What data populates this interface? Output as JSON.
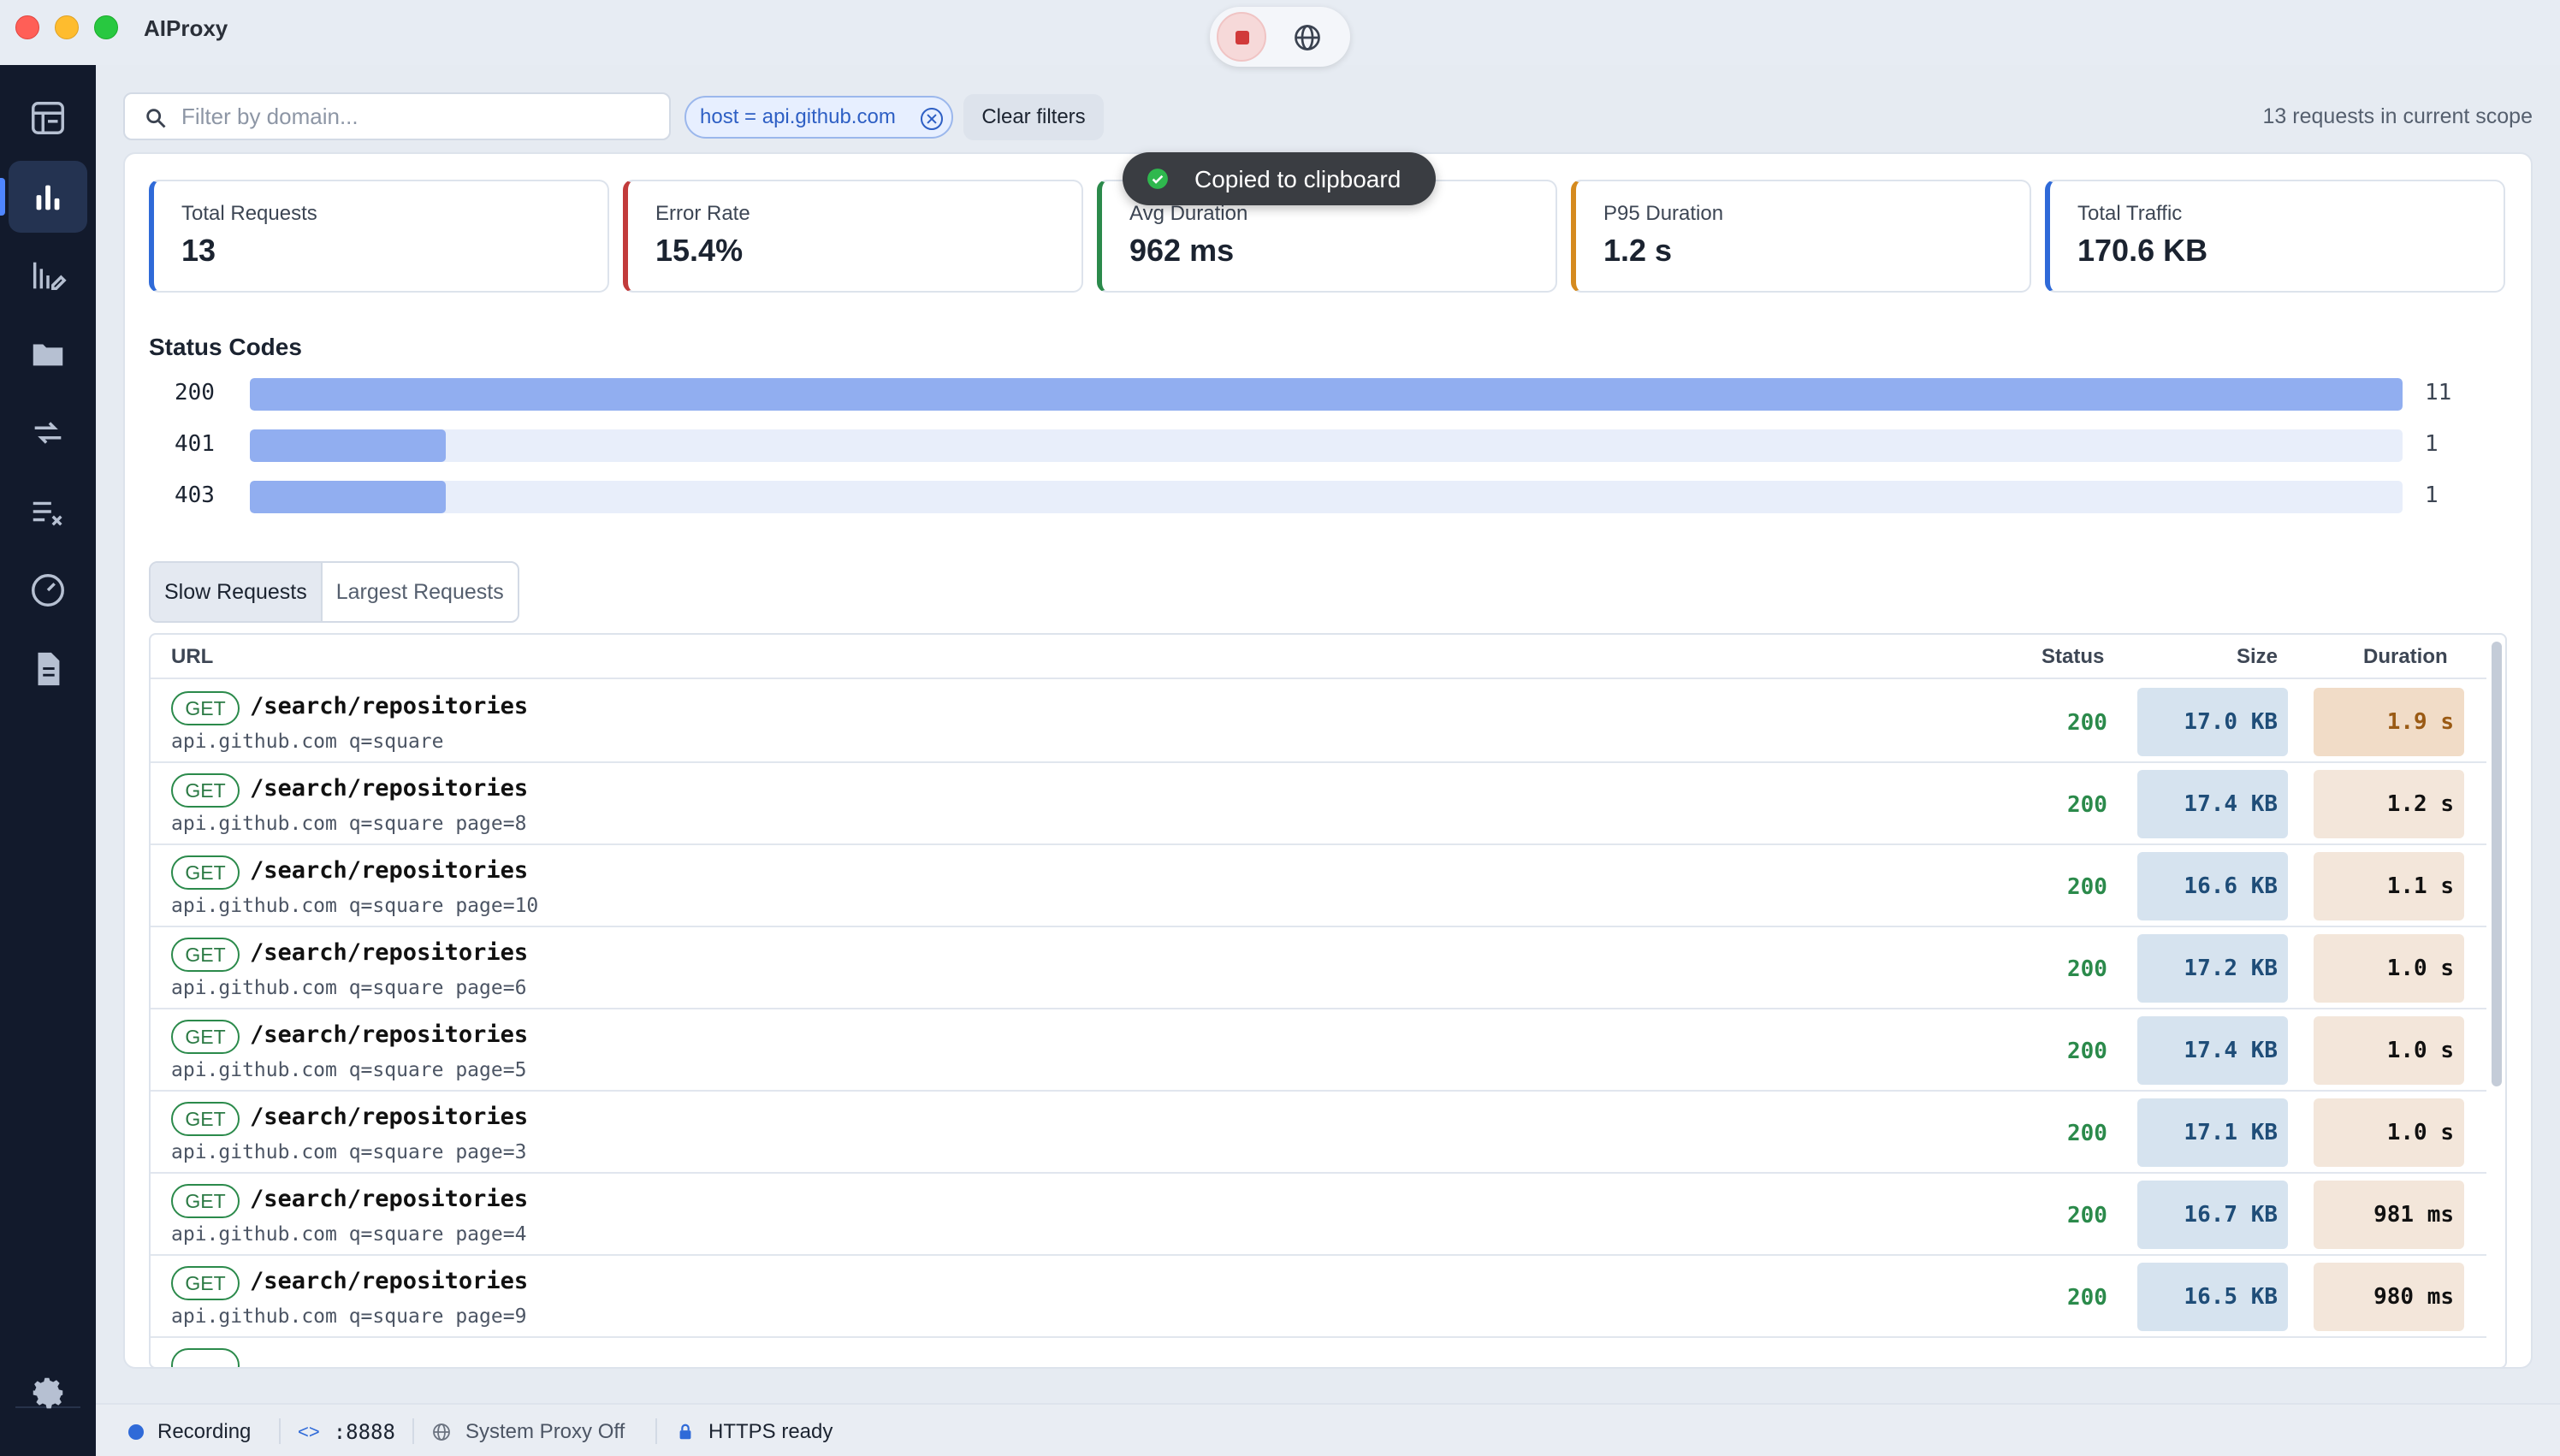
{
  "app": {
    "title": "AIProxy"
  },
  "filter": {
    "search_placeholder": "Filter by domain...",
    "chip_label": "host = api.github.com",
    "clear_label": "Clear filters",
    "scope_count": "13 requests in current scope"
  },
  "toast": {
    "text": "Copied to clipboard"
  },
  "stats": [
    {
      "label": "Total Requests",
      "value": "13",
      "color": "#2f6ad8"
    },
    {
      "label": "Error Rate",
      "value": "15.4%",
      "color": "#c23b3b"
    },
    {
      "label": "Avg Duration",
      "value": "962 ms",
      "color": "#2b8a4b"
    },
    {
      "label": "P95 Duration",
      "value": "1.2 s",
      "color": "#d58a1e"
    },
    {
      "label": "Total Traffic",
      "value": "170.6 KB",
      "color": "#2f6ad8"
    }
  ],
  "status_codes": {
    "title": "Status Codes",
    "rows": [
      {
        "code": "200",
        "count": 11
      },
      {
        "code": "401",
        "count": 1
      },
      {
        "code": "403",
        "count": 1
      }
    ]
  },
  "tabs": [
    "Slow Requests",
    "Largest Requests"
  ],
  "table": {
    "headers": {
      "url": "URL",
      "status": "Status",
      "size": "Size",
      "duration": "Duration"
    },
    "rows": [
      {
        "method": "GET",
        "path": "/search/repositories",
        "host": "api.github.com q=square",
        "status": "200",
        "size": "17.0 KB",
        "duration": "1.9 s"
      },
      {
        "method": "GET",
        "path": "/search/repositories",
        "host": "api.github.com q=square page=8",
        "status": "200",
        "size": "17.4 KB",
        "duration": "1.2 s"
      },
      {
        "method": "GET",
        "path": "/search/repositories",
        "host": "api.github.com q=square page=10",
        "status": "200",
        "size": "16.6 KB",
        "duration": "1.1 s"
      },
      {
        "method": "GET",
        "path": "/search/repositories",
        "host": "api.github.com q=square page=6",
        "status": "200",
        "size": "17.2 KB",
        "duration": "1.0 s"
      },
      {
        "method": "GET",
        "path": "/search/repositories",
        "host": "api.github.com q=square page=5",
        "status": "200",
        "size": "17.4 KB",
        "duration": "1.0 s"
      },
      {
        "method": "GET",
        "path": "/search/repositories",
        "host": "api.github.com q=square page=3",
        "status": "200",
        "size": "17.1 KB",
        "duration": "1.0 s"
      },
      {
        "method": "GET",
        "path": "/search/repositories",
        "host": "api.github.com q=square page=4",
        "status": "200",
        "size": "16.7 KB",
        "duration": "981 ms"
      },
      {
        "method": "GET",
        "path": "/search/repositories",
        "host": "api.github.com q=square page=9",
        "status": "200",
        "size": "16.5 KB",
        "duration": "980 ms"
      }
    ]
  },
  "statusbar": {
    "recording": "Recording",
    "port": ":8888",
    "proxy": "System Proxy Off",
    "https": "HTTPS ready"
  },
  "sidebar": {
    "items": [
      "traffic-icon",
      "stats-icon",
      "rules-icon",
      "folder-icon",
      "compare-icon",
      "checklist-icon",
      "speed-icon",
      "document-icon"
    ],
    "settings": "gear-icon"
  }
}
